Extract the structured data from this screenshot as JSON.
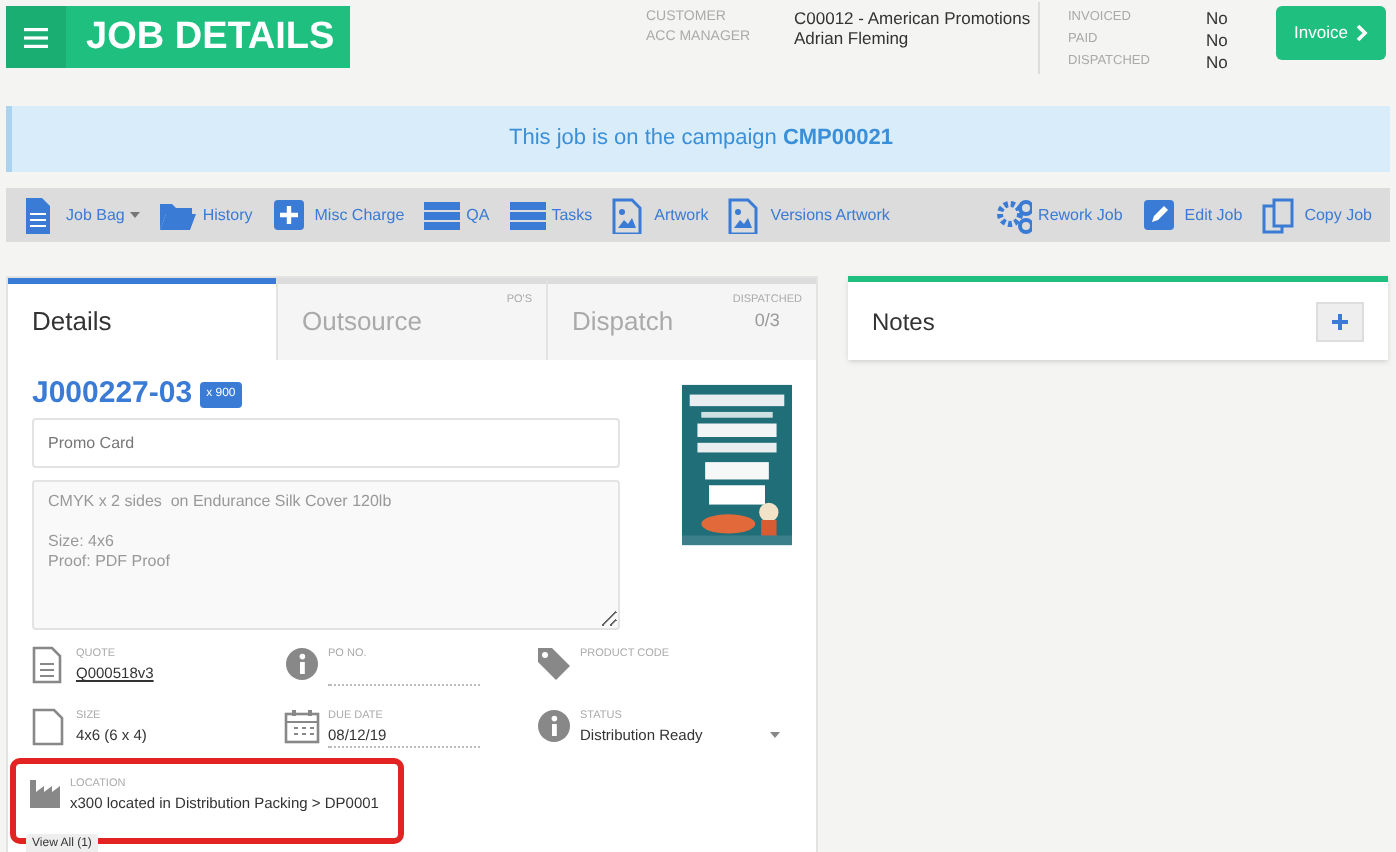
{
  "header": {
    "title": "JOB DETAILS",
    "meta": [
      {
        "label": "CUSTOMER",
        "value": "C00012 - American Promotions"
      },
      {
        "label": "ACC MANAGER",
        "value": "Adrian Fleming"
      }
    ],
    "flags": [
      {
        "label": "INVOICED",
        "value": "No"
      },
      {
        "label": "PAID",
        "value": "No"
      },
      {
        "label": "DISPATCHED",
        "value": "No"
      }
    ],
    "invoice_button": "Invoice"
  },
  "banner": {
    "text": "This job is on the campaign **CMP00021**"
  },
  "toolbar": {
    "left": [
      {
        "label": "Job Bag",
        "dropdown": true
      },
      {
        "label": "History",
        "dropdown": false
      },
      {
        "label": "Misc Charge",
        "dropdown": false
      },
      {
        "label": "QA",
        "dropdown": false
      },
      {
        "label": "Tasks",
        "dropdown": false
      },
      {
        "label": "Artwork",
        "dropdown": false
      },
      {
        "label": "Versions Artwork",
        "dropdown": false
      }
    ],
    "right": [
      {
        "label": "Rework Job"
      },
      {
        "label": "Edit Job"
      },
      {
        "label": "Copy Job"
      }
    ]
  },
  "tabs": [
    {
      "label": "Details",
      "selected": true
    },
    {
      "label": "Outsource",
      "selected": false,
      "corner_label": "PO'S"
    },
    {
      "label": "Dispatch",
      "selected": false,
      "corner_label": "DISPATCHED",
      "corner_value": "0/3"
    }
  ],
  "job": {
    "number": "J000227-03",
    "quantity": "x 900",
    "name": "Promo Card",
    "description": "CMYK x 2 sides  on Endurance Silk Cover 120lb\n\nSize: 4x6\nProof: PDF Proof",
    "fields": [
      {
        "label": "QUOTE",
        "value": "Q000518v3",
        "kind": "link"
      },
      {
        "label": "PO NO.",
        "kind": "input"
      },
      {
        "label": "PRODUCT CODE",
        "kind": "plain"
      },
      {
        "label": "SIZE",
        "value": "4x6 (6 x 4)",
        "kind": "plain"
      },
      {
        "label": "DUE DATE",
        "value": "08/12/19",
        "kind": "input"
      },
      {
        "label": "STATUS",
        "value": "Distribution Ready",
        "kind": "select"
      }
    ],
    "location": {
      "label": "LOCATION",
      "value": "x300 located in Distribution Packing > DP0001",
      "view_all": "View All (1)",
      "highlighted": true
    }
  },
  "notes": {
    "title": "Notes"
  }
}
